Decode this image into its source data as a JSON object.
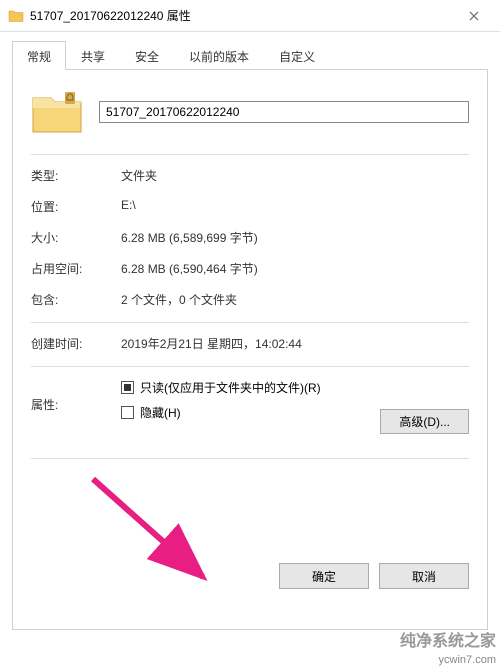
{
  "window": {
    "title": "51707_20170622012240 属性",
    "close_label": "×"
  },
  "tabs": {
    "general": "常规",
    "share": "共享",
    "security": "安全",
    "prev": "以前的版本",
    "custom": "自定义"
  },
  "general": {
    "name": "51707_20170622012240",
    "type_label": "类型:",
    "type_value": "文件夹",
    "location_label": "位置:",
    "location_value": "E:\\",
    "size_label": "大小:",
    "size_value": "6.28 MB (6,589,699 字节)",
    "ondisk_label": "占用空间:",
    "ondisk_value": "6.28 MB (6,590,464 字节)",
    "contains_label": "包含:",
    "contains_value": "2 个文件，0 个文件夹",
    "created_label": "创建时间:",
    "created_value": "2019年2月21日 星期四，14:02:44",
    "attr_label": "属性:",
    "readonly_label": "只读(仅应用于文件夹中的文件)(R)",
    "hidden_label": "隐藏(H)",
    "advanced_label": "高级(D)..."
  },
  "buttons": {
    "ok": "确定",
    "cancel": "取消"
  },
  "watermark": {
    "cn": "纯净系统之家",
    "url": "ycwin7.com"
  }
}
